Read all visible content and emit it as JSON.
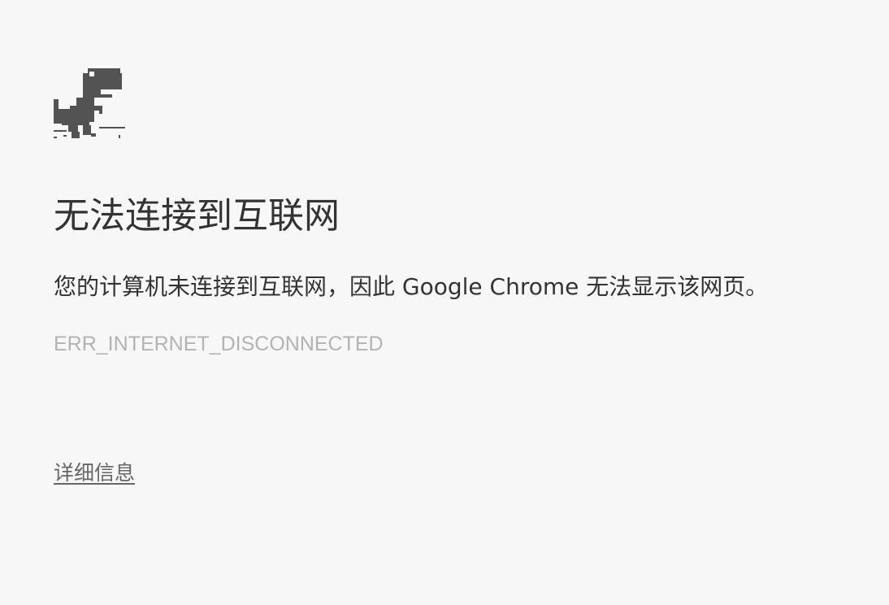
{
  "error_page": {
    "dino_icon": "offline-dinosaur-icon",
    "title": "无法连接到互联网",
    "message": "您的计算机未连接到互联网，因此 Google Chrome 无法显示该网页。",
    "error_code": "ERR_INTERNET_DISCONNECTED",
    "details_link": "详细信息"
  },
  "colors": {
    "background": "#f7f7f7",
    "text": "#333333",
    "error_code": "#b3b3b3",
    "details_link": "#666666",
    "dino": "#535353"
  }
}
